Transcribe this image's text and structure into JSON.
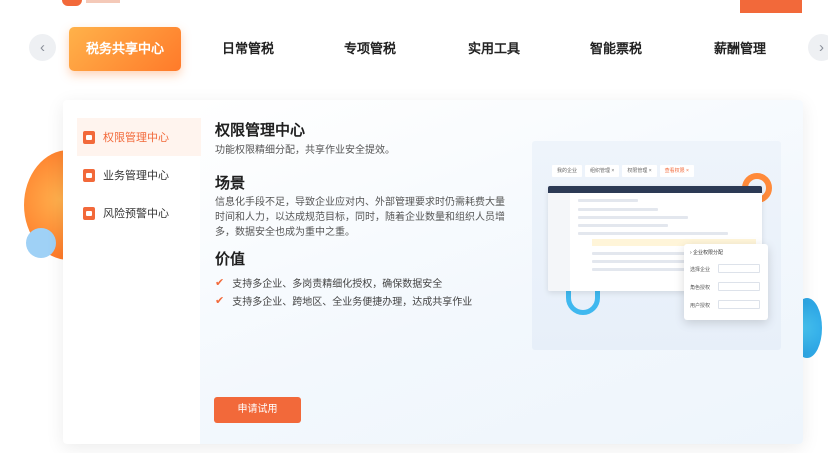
{
  "nav": {
    "tabs": [
      {
        "label": "税务共享中心",
        "active": true
      },
      {
        "label": "日常管税",
        "active": false
      },
      {
        "label": "专项管税",
        "active": false
      },
      {
        "label": "实用工具",
        "active": false
      },
      {
        "label": "智能票税",
        "active": false
      },
      {
        "label": "薪酬管理",
        "active": false
      }
    ],
    "prev_icon": "chevron-left-icon",
    "next_icon": "chevron-right-icon"
  },
  "sidebar": {
    "items": [
      {
        "label": "权限管理中心",
        "active": true
      },
      {
        "label": "业务管理中心",
        "active": false
      },
      {
        "label": "风险预警中心",
        "active": false
      }
    ]
  },
  "content": {
    "title": "权限管理中心",
    "subtitle": "功能权限精细分配，共享作业安全提效。",
    "scenario_heading": "场景",
    "scenario_text": "信息化手段不足，导致企业应对内、外部管理要求时仍需耗费大量时间和人力，以达成规范目标，同时，随着企业数量和组织人员增多，数据安全也成为重中之重。",
    "value_heading": "价值",
    "values": [
      "支持多企业、多岗责精细化授权，确保数据安全",
      "支持多企业、跨地区、全业务便捷办理，达成共享作业"
    ],
    "apply_button": "申请试用"
  },
  "illustration": {
    "tabs": [
      "我的企业",
      "组织管理 ×",
      "权限管理 ×",
      "查看权限 ×"
    ],
    "popup_title": "› 企业权限分配",
    "popup_rows": [
      "选择企业",
      "角色授权",
      "用户授权"
    ]
  },
  "colors": {
    "accent": "#f2693a",
    "accent_light": "#fff4ee",
    "nav_gradient_start": "#ffb24a",
    "nav_gradient_end": "#ff7a2a"
  }
}
